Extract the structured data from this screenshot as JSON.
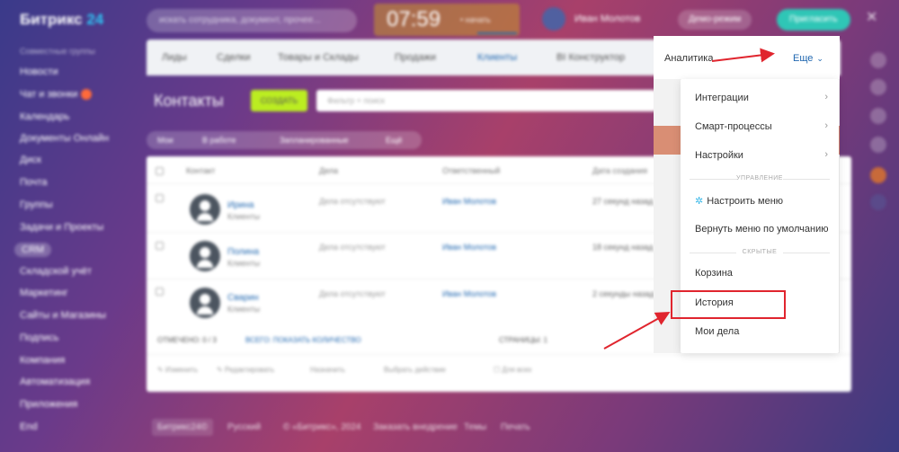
{
  "topbar": {
    "logo_main": "Битрикс",
    "logo_num": "24",
    "search_placeholder": "искать сотрудника, документ, прочее...",
    "clock_time": "07:59",
    "clock_status": "• начать",
    "user_name": "Иван Молотов",
    "demo_label": "Демо-режим",
    "invite_label": "Пригласить",
    "close_glyph": "✕"
  },
  "sidebar": {
    "header": "Совместные группы",
    "items": [
      {
        "label": "Новости"
      },
      {
        "label": "Чат и звонки"
      },
      {
        "label": "Календарь"
      },
      {
        "label": "Документы Онлайн"
      },
      {
        "label": "Диск"
      },
      {
        "label": "Почта"
      },
      {
        "label": "Группы"
      },
      {
        "label": "Задачи и Проекты"
      },
      {
        "label": "CRM"
      },
      {
        "label": "Складской учёт"
      },
      {
        "label": "Маркетинг"
      },
      {
        "label": "Сайты и Магазины"
      },
      {
        "label": "Подпись"
      },
      {
        "label": "Компания"
      },
      {
        "label": "Автоматизация"
      },
      {
        "label": "Приложения"
      },
      {
        "label": "End"
      }
    ]
  },
  "nav": {
    "items": [
      {
        "label": "Лиды"
      },
      {
        "label": "Сделки"
      },
      {
        "label": "Товары и Склады"
      },
      {
        "label": "Продажи"
      },
      {
        "label": "Клиенты"
      },
      {
        "label": "BI Конструктор"
      }
    ]
  },
  "page": {
    "title": "Контакты",
    "add_button": "СОЗДАТЬ",
    "filter_placeholder": "Фильтр + поиск",
    "pills": [
      "Мои",
      "В работе",
      "Запланированные",
      "Ещё"
    ]
  },
  "table": {
    "headers": [
      "Контакт",
      "Дела",
      "Ответственный",
      "Дата создания"
    ],
    "rows": [
      {
        "name": "Ирина",
        "type": "Клиенты",
        "deal": "Дела отсутствуют",
        "resp": "Иван Молотов",
        "date": "27 секунд назад"
      },
      {
        "name": "Полина",
        "type": "Клиенты",
        "deal": "Дела отсутствуют",
        "resp": "Иван Молотов",
        "date": "18 секунд назад"
      },
      {
        "name": "Сварин",
        "type": "Клиенты",
        "deal": "Дела отсутствуют",
        "resp": "Иван Молотов",
        "date": "2 секунды назад"
      }
    ],
    "footer_selected": "ОТМЕЧЕНО: 0 / 3",
    "footer_total": "ВСЕГО: ПОКАЗАТЬ КОЛИЧЕСТВО",
    "footer_pages": "СТРАНИЦЫ: 1",
    "actions": [
      "✎ Изменить",
      "✎ Редактировать",
      "Назначить",
      "Выбрать действие",
      "☐ Для всех"
    ]
  },
  "footer": {
    "brand": "Битрикс24©",
    "lang": "Русский",
    "copyright": "© «Битрикс», 2024",
    "order": "Заказать внедрение",
    "themes": "Темы",
    "print": "Печать"
  },
  "more_menu": {
    "analytics_label": "Аналитика",
    "more_label": "Еще",
    "chevron": "⌄",
    "items_top": [
      {
        "label": "Интеграции",
        "arrow": "›"
      },
      {
        "label": "Смарт-процессы",
        "arrow": "›"
      },
      {
        "label": "Настройки",
        "arrow": "›"
      }
    ],
    "section_manage": "УПРАВЛЕНИЕ",
    "configure_icon": "✲",
    "configure_label": "Настроить меню",
    "reset_label": "Вернуть меню по умолчанию",
    "section_hidden": "СКРЫТЫЕ",
    "hidden_items": [
      {
        "label": "Корзина"
      },
      {
        "label": "История"
      },
      {
        "label": "Мои дела"
      }
    ]
  },
  "annotation_color": "#e0252e"
}
